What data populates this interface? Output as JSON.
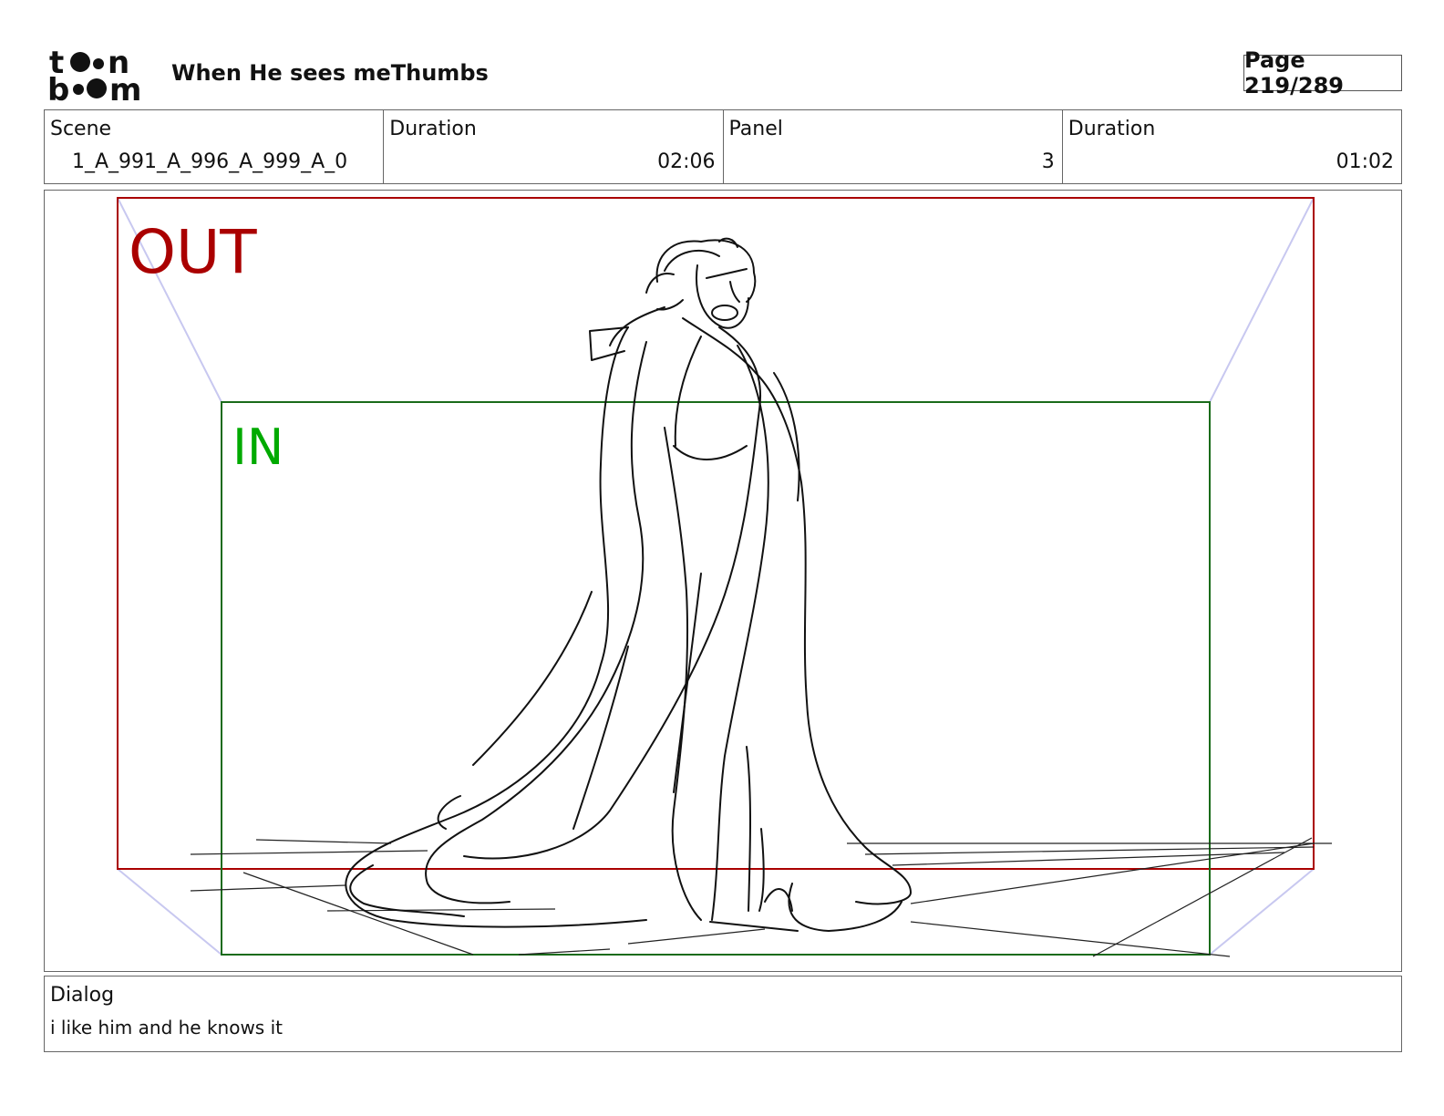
{
  "document": {
    "title": "When He sees meThumbs",
    "page_label": "Page 219/289",
    "logo_text": "toon boom"
  },
  "info": {
    "scene_label": "Scene",
    "scene_value": "1_A_991_A_996_A_999_A_0",
    "scene_duration_label": "Duration",
    "scene_duration_value": "02:06",
    "panel_label": "Panel",
    "panel_value": "3",
    "panel_duration_label": "Duration",
    "panel_duration_value": "01:02"
  },
  "frame": {
    "out_label": "OUT",
    "in_label": "IN",
    "out_color": "#aa0000",
    "in_color": "#00aa00",
    "in_border_color": "#1a6b1a",
    "guide_color": "#c8c8f0"
  },
  "dialog": {
    "label": "Dialog",
    "text": "i like him and he knows it"
  }
}
